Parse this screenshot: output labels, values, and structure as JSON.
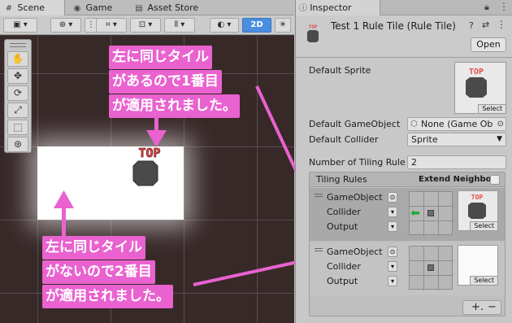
{
  "scene": {
    "tabs": [
      {
        "label": "Scene",
        "icon": "hash-icon"
      },
      {
        "label": "Game",
        "icon": "gamepad-icon"
      },
      {
        "label": "Asset Store",
        "icon": "store-icon"
      }
    ],
    "toolbar": {
      "mode_2d": "2D"
    },
    "sprite_text": "TOP"
  },
  "annotations": {
    "upper": [
      "左に同じタイル",
      "があるので1番目",
      "が適用されました。"
    ],
    "lower": [
      "左に同じタイル",
      "がないので2番目",
      "が適用されました。"
    ],
    "color": "#e962cf"
  },
  "inspector": {
    "tab_label": "Inspector",
    "asset_title": "Test 1 Rule Tile (Rule Tile)",
    "open_label": "Open",
    "default_sprite_label": "Default Sprite",
    "select_label": "Select",
    "default_gameobject_label": "Default GameObject",
    "default_gameobject_value": "None (Game Ob",
    "default_collider_label": "Default Collider",
    "default_collider_value": "Sprite",
    "tiling_rule_count_label": "Number of Tiling Rule",
    "tiling_rule_count_value": "2",
    "tiling_rules_label": "Tiling Rules",
    "extend_neighbor_label": "Extend Neighbor",
    "rules": [
      {
        "gameobject": "GameObject",
        "collider": "Collider",
        "output": "Output",
        "neighbor_arrow": "left",
        "select": "Select"
      },
      {
        "gameobject": "GameObject",
        "collider": "Collider",
        "output": "Output",
        "neighbor_arrow": "none",
        "select": "Select"
      }
    ],
    "add_label": "+.",
    "remove_label": "−"
  }
}
